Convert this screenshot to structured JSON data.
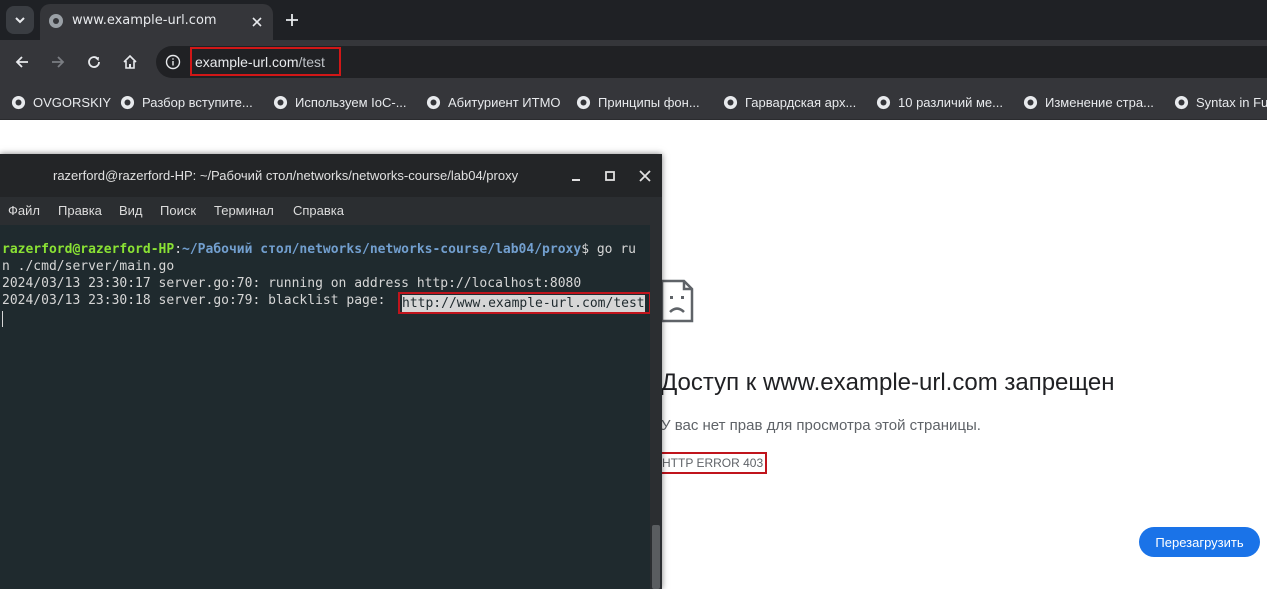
{
  "browser": {
    "tab": {
      "title": "www.example-url.com"
    },
    "address_bar": {
      "host": "example-url.com",
      "path": "/test"
    },
    "bookmarks": [
      {
        "label": "OVGORSKIY"
      },
      {
        "label": "Разбор вступите..."
      },
      {
        "label": "Используем IoC-..."
      },
      {
        "label": "Абитуриент ИТМО"
      },
      {
        "label": "Принципы фон..."
      },
      {
        "label": "Гарвардская арх..."
      },
      {
        "label": "10 различий ме..."
      },
      {
        "label": "Изменение стра..."
      },
      {
        "label": "Syntax in Fu"
      }
    ]
  },
  "error_page": {
    "title": "Доступ к www.example-url.com запрещен",
    "description": "У вас нет прав для просмотра этой страницы.",
    "error_code": "HTTP ERROR 403",
    "reload_label": "Перезагрузить"
  },
  "terminal": {
    "title": "razerford@razerford-HP: ~/Рабочий стол/networks/networks-course/lab04/proxy",
    "menu": [
      "Файл",
      "Правка",
      "Вид",
      "Поиск",
      "Терминал",
      "Справка"
    ],
    "prompt_user": "razerford@razerford-HP",
    "prompt_sep": ":",
    "prompt_path": "~/Рабочий стол/networks/networks-course/lab04/proxy",
    "prompt_cmd": "$ go ru",
    "cmd_wrap": "n ./cmd/server/main.go",
    "log1": "2024/03/13 23:30:17 server.go:70: running on address http://localhost:8080",
    "log2_prefix": "2024/03/13 23:30:18 server.go:79: blacklist page: ",
    "log2_url": "http://www.example-url.com/test"
  },
  "colors": {
    "highlight_border": "#c0141c",
    "prompt_user": "#8ae234",
    "prompt_path": "#729fcf",
    "reload_button": "#1a73e8"
  }
}
